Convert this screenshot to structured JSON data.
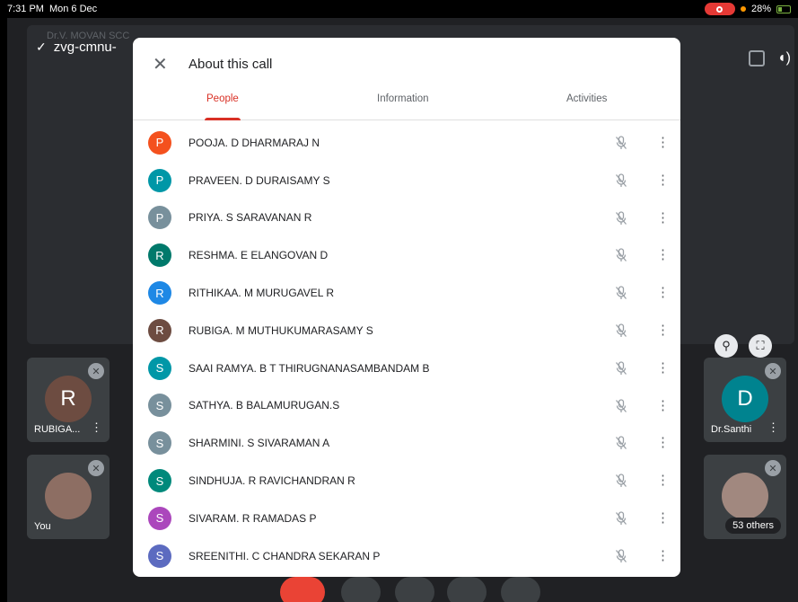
{
  "status_bar": {
    "time": "7:31 PM",
    "date": "Mon 6 Dec",
    "battery": "28%"
  },
  "meeting": {
    "code": "zvg-cmnu-",
    "presenter_ghost": "Dr.V. MOVAN SCC",
    "tiles": [
      {
        "initial": "R",
        "name": "RUBIGA...",
        "color": "#6d4c41"
      },
      {
        "initial": "",
        "name": "You",
        "color": "#8d6e63"
      },
      {
        "initial": "D",
        "name": "Dr.Santhi",
        "color": "#00838f"
      },
      {
        "initial": "",
        "name": "53 others",
        "color": "#a1887f"
      }
    ]
  },
  "dialog": {
    "title": "About this call",
    "tabs": [
      "People",
      "Information",
      "Activities"
    ],
    "active_tab": "People",
    "participants": [
      {
        "initial": "P",
        "name": "POOJA. D DHARMARAJ N",
        "color": "#f4511e"
      },
      {
        "initial": "P",
        "name": "PRAVEEN. D DURAISAMY S",
        "color": "#0097a7"
      },
      {
        "initial": "P",
        "name": "PRIYA. S SARAVANAN R",
        "color": "#78909c"
      },
      {
        "initial": "R",
        "name": "RESHMA. E ELANGOVAN D",
        "color": "#00796b"
      },
      {
        "initial": "R",
        "name": "RITHIKAA. M MURUGAVEL R",
        "color": "#1e88e5"
      },
      {
        "initial": "R",
        "name": "RUBIGA. M MUTHUKUMARASAMY S",
        "color": "#6d4c41"
      },
      {
        "initial": "S",
        "name": "SAAI RAMYA. B T THIRUGNANASAMBANDAM B",
        "color": "#0097a7"
      },
      {
        "initial": "S",
        "name": "SATHYA. B BALAMURUGAN.S",
        "color": "#78909c"
      },
      {
        "initial": "S",
        "name": "SHARMINI. S SIVARAMAN A",
        "color": "#78909c"
      },
      {
        "initial": "S",
        "name": "SINDHUJA. R RAVICHANDRAN R",
        "color": "#00897b"
      },
      {
        "initial": "S",
        "name": "SIVARAM. R RAMADAS P",
        "color": "#ab47bc"
      },
      {
        "initial": "S",
        "name": "SREENITHI. C CHANDRA SEKARAN P",
        "color": "#5c6bc0"
      }
    ]
  },
  "icons": {
    "close": "close-icon",
    "mic_off": "mic-off-icon",
    "more": "more-vert-icon"
  }
}
